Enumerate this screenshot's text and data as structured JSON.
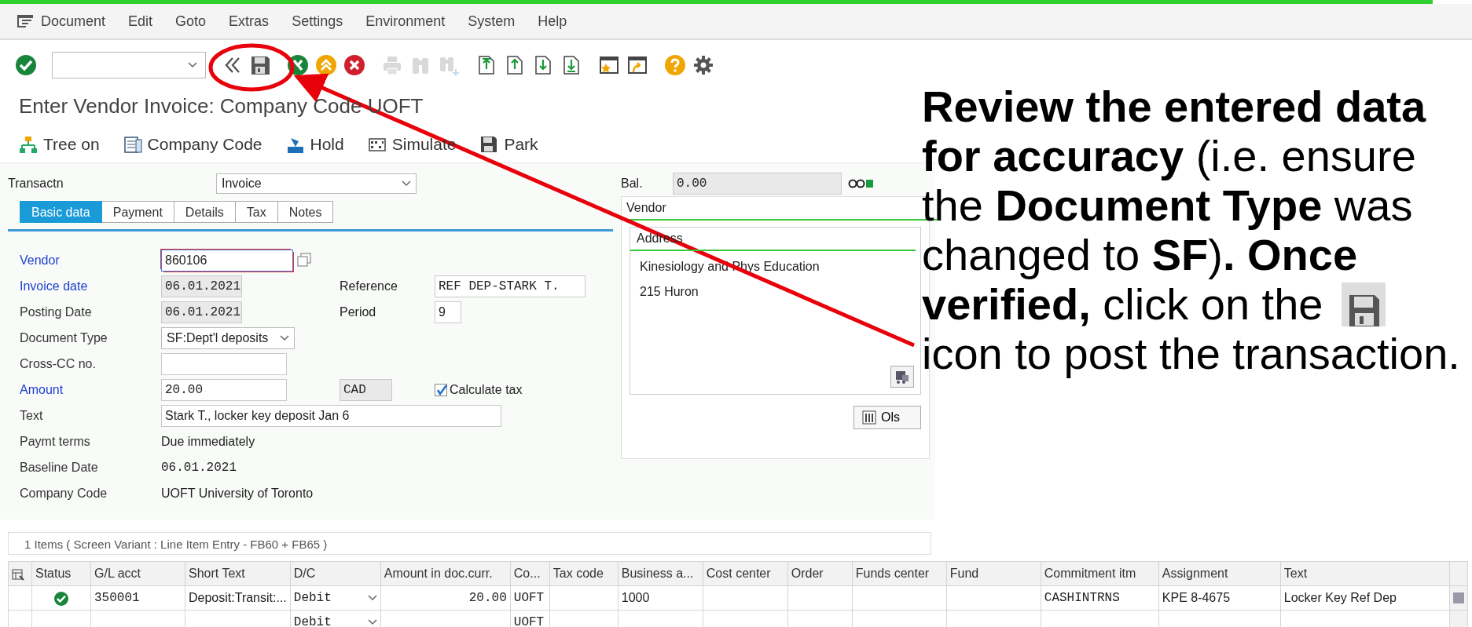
{
  "menu_bar": {
    "items": [
      "Document",
      "Edit",
      "Goto",
      "Extras",
      "Settings",
      "Environment",
      "System",
      "Help"
    ]
  },
  "toolbar": {
    "groups": [
      {
        "items": [
          {
            "kind": "ok",
            "disabled": false
          }
        ]
      },
      {
        "items": [
          {
            "kind": "command_field"
          }
        ]
      },
      {
        "items": [
          {
            "kind": "back",
            "disabled": false
          },
          {
            "kind": "save",
            "disabled": false
          }
        ]
      },
      {
        "items": [
          {
            "kind": "exit",
            "disabled": false
          },
          {
            "kind": "up",
            "disabled": false
          },
          {
            "kind": "cancel",
            "disabled": false
          }
        ]
      },
      {
        "items": [
          {
            "kind": "print",
            "disabled": true
          },
          {
            "kind": "find",
            "disabled": true
          },
          {
            "kind": "find_next",
            "disabled": true
          }
        ]
      },
      {
        "items": [
          {
            "kind": "first_page",
            "disabled": false
          },
          {
            "kind": "previous_page",
            "disabled": false
          },
          {
            "kind": "next_page",
            "disabled": false
          },
          {
            "kind": "last_page",
            "disabled": false
          }
        ]
      },
      {
        "items": [
          {
            "kind": "new_session",
            "disabled": false
          },
          {
            "kind": "shortcut",
            "disabled": false
          }
        ]
      },
      {
        "items": [
          {
            "kind": "help",
            "disabled": false
          },
          {
            "kind": "settings",
            "disabled": false
          }
        ]
      }
    ]
  },
  "window": {
    "title": "Enter Vendor Invoice: Company Code UOFT"
  },
  "app_toolbar": [
    {
      "kind": "tree",
      "label": "Tree on"
    },
    {
      "kind": "company",
      "label": "Company Code"
    },
    {
      "kind": "hold",
      "label": "Hold"
    },
    {
      "kind": "simulate",
      "label": "Simulate"
    },
    {
      "kind": "park",
      "label": "Park"
    }
  ],
  "transaction": {
    "label": "Transactn",
    "value": "Invoice"
  },
  "tabs": [
    {
      "label": "Basic data",
      "selected": true
    },
    {
      "label": "Payment",
      "selected": false
    },
    {
      "label": "Details",
      "selected": false
    },
    {
      "label": "Tax",
      "selected": false
    },
    {
      "label": "Notes",
      "selected": false
    }
  ],
  "form": {
    "rows": [
      {
        "label": "Vendor",
        "required": true,
        "field": {
          "kind": "input",
          "value": "860106",
          "focused": true
        }
      },
      {
        "label": "Invoice date",
        "required": true,
        "field": {
          "kind": "readonly",
          "value": "06.01.2021",
          "focused": false
        },
        "side": {
          "label": "Reference",
          "field": {
            "kind": "input",
            "value": "REF DEP-STARK T.",
            "focused": false
          }
        }
      },
      {
        "label": "Posting Date",
        "required": false,
        "field": {
          "kind": "readonly",
          "value": "06.01.2021",
          "focused": false
        },
        "side": {
          "label": "Period",
          "field": {
            "kind": "input",
            "value": "9",
            "focused": false
          }
        }
      },
      {
        "label": "Document Type",
        "required": false,
        "field": {
          "kind": "select",
          "value": "SF:Dept'l deposits",
          "focused": false
        }
      },
      {
        "label": "Cross-CC no.",
        "required": false,
        "field": {
          "kind": "input",
          "focused": false
        }
      },
      {
        "label": "Amount",
        "required": true,
        "field": {
          "kind": "input",
          "value": "20.00",
          "focused": false
        },
        "currency": "CAD",
        "checkbox": {
          "label": "Calculate tax",
          "checked": true
        }
      },
      {
        "label": "Text",
        "required": false,
        "field": {
          "kind": "input",
          "value": "Stark T., locker key deposit Jan 6",
          "focused": false
        }
      },
      {
        "label": "Paymt terms",
        "required": false,
        "field": {
          "kind": "plain",
          "value": "Due immediately"
        }
      },
      {
        "label": "Baseline Date",
        "required": false,
        "field": {
          "kind": "plain_mono",
          "value": "06.01.2021"
        }
      },
      {
        "label": "Company Code",
        "required": false,
        "field": {
          "kind": "plain",
          "value": "UOFT University of Toronto"
        }
      }
    ]
  },
  "balance": {
    "label": "Bal.",
    "value": "0.00"
  },
  "vendor_panel": {
    "title": "Vendor",
    "address_title": "Address",
    "address_lines": [
      "Kinesiology and Phys Education",
      "215 Huron"
    ],
    "button": "Ols"
  },
  "items_table": {
    "title": "1 Items ( Screen Variant : Line Item Entry - FB60 + FB65 )",
    "columns": [
      "Status",
      "G/L acct",
      "Short Text",
      "D/C",
      "Amount in doc.curr.",
      "Co...",
      "Tax code",
      "Business a...",
      "Cost center",
      "Order",
      "Funds center",
      "Fund",
      "Commitment itm",
      "Assignment",
      "Text"
    ],
    "rows": [
      {
        "ok": true,
        "cells": [
          "",
          "350001",
          "Deposit:Transit:...",
          "Debit",
          "20.00",
          "UOFT",
          null,
          "1000",
          null,
          null,
          null,
          null,
          "CASHINTRNS",
          "KPE 8-4675",
          "Locker Key Ref Dep"
        ]
      },
      {
        "ok": false,
        "cells": [
          "",
          null,
          null,
          "Debit",
          null,
          "UOFT",
          null,
          null,
          null,
          null,
          null,
          null,
          null,
          null,
          null
        ]
      }
    ]
  },
  "annotation": {
    "text_before": "**Review the entered data for accuracy** (i.e. ensure the **Document Type** was changed to **SF**)**. Once**",
    "text_icon_line": "**verified,** click on the",
    "text_after": "icon to post the transaction."
  }
}
